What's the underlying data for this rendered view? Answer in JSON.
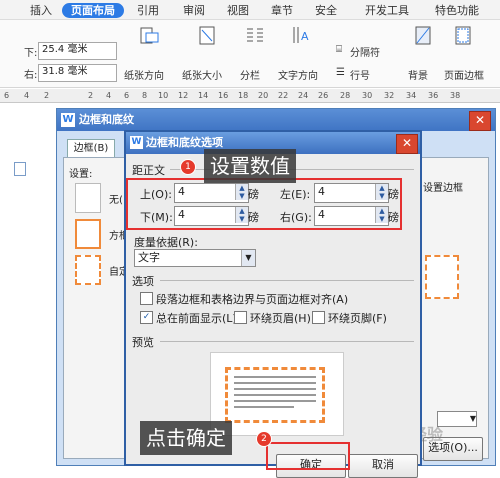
{
  "ribbon": {
    "tabs": [
      "插入",
      "页面布局",
      "引用",
      "审阅",
      "视图",
      "章节",
      "安全",
      "开发工具",
      "特色功能"
    ],
    "margin_bottom_label": "下:",
    "margin_bottom_value": "25.4 毫米",
    "margin_right_label": "右:",
    "margin_right_value": "31.8 毫米",
    "buttons": [
      "纸张方向",
      "纸张大小",
      "分栏",
      "文字方向",
      "背景",
      "页面边框"
    ],
    "separator_label": "分隔符",
    "line_number_label": "行号"
  },
  "ruler": {
    "numbers": [
      "6",
      "4",
      "2",
      "2",
      "4",
      "6",
      "8",
      "10",
      "12",
      "14",
      "16",
      "18",
      "20",
      "22",
      "24",
      "26",
      "28",
      "30",
      "32",
      "34",
      "36",
      "38"
    ]
  },
  "outer_dialog": {
    "title": "边框和底纹",
    "tab_label": "边框(B)",
    "settings_label": "设置:",
    "setting_none": "无(",
    "setting_box": "方框",
    "setting_custom": "自定",
    "right_hint": "设置边框",
    "options_button": "选项(O)...",
    "watermark": "Bai 经验"
  },
  "inner_dialog": {
    "title": "边框和底纹选项",
    "from_text_label": "距正文",
    "top_label": "上(O):",
    "top_value": "4",
    "bottom_label": "下(M):",
    "bottom_value": "4",
    "left_label": "左(E):",
    "left_value": "4",
    "right_label": "右(G):",
    "right_value": "4",
    "unit": "磅",
    "measure_label": "度量依据(R):",
    "measure_value": "文字",
    "options_label": "选项",
    "opt_align": "段落边框和表格边界与页面边框对齐(A)",
    "opt_front": "总在前面显示(L)",
    "opt_header": "环绕页眉(H)",
    "opt_footer": "环绕页脚(F)",
    "preview_label": "预览",
    "ok_button": "确定",
    "cancel_button": "取消"
  },
  "annotations": {
    "step1_number": "1",
    "step1_text": "设置数值",
    "step2_number": "2",
    "step2_text": "点击确定"
  },
  "colors": {
    "accent": "#2d7be5",
    "annotation_red": "#e53030",
    "border_orange": "#f08a3a"
  }
}
